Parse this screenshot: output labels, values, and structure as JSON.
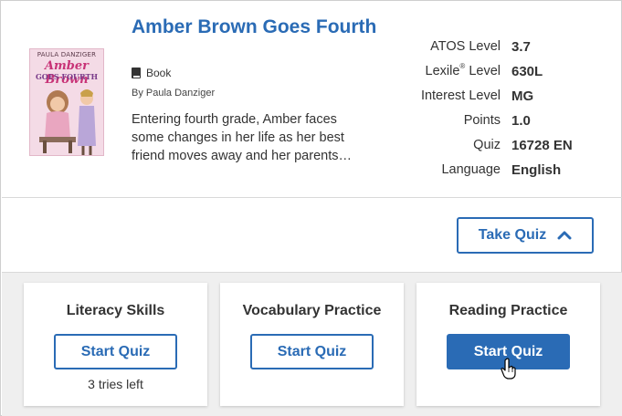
{
  "book": {
    "title": "Amber Brown Goes Fourth",
    "format_icon": "book-icon",
    "format": "Book",
    "author": "By Paula Danziger",
    "description": "Entering fourth grade, Amber faces some changes in her life as her best friend moves away and her parents…",
    "cover": {
      "author_text": "PAULA DANZIGER",
      "title_line1": "Amber Brown",
      "title_line2": "GOES FOURTH"
    }
  },
  "stats": [
    {
      "label": "ATOS Level",
      "value": "3.7"
    },
    {
      "label": "Lexile",
      "label_sup": "®",
      "label_suffix": " Level",
      "value": "630L"
    },
    {
      "label": "Interest Level",
      "value": "MG"
    },
    {
      "label": "Points",
      "value": "1.0"
    },
    {
      "label": "Quiz",
      "value": "16728 EN"
    },
    {
      "label": "Language",
      "value": "English"
    }
  ],
  "take_quiz": {
    "label": "Take Quiz",
    "icon": "chevron-up-icon"
  },
  "quizzes": [
    {
      "title": "Literacy Skills",
      "button": "Start Quiz",
      "note": "3 tries left"
    },
    {
      "title": "Vocabulary Practice",
      "button": "Start Quiz"
    },
    {
      "title": "Reading Practice",
      "button": "Start Quiz"
    }
  ],
  "colors": {
    "accent": "#2a6bb5",
    "tray_background": "#efefef"
  },
  "cursor": "hand-pointer-icon"
}
